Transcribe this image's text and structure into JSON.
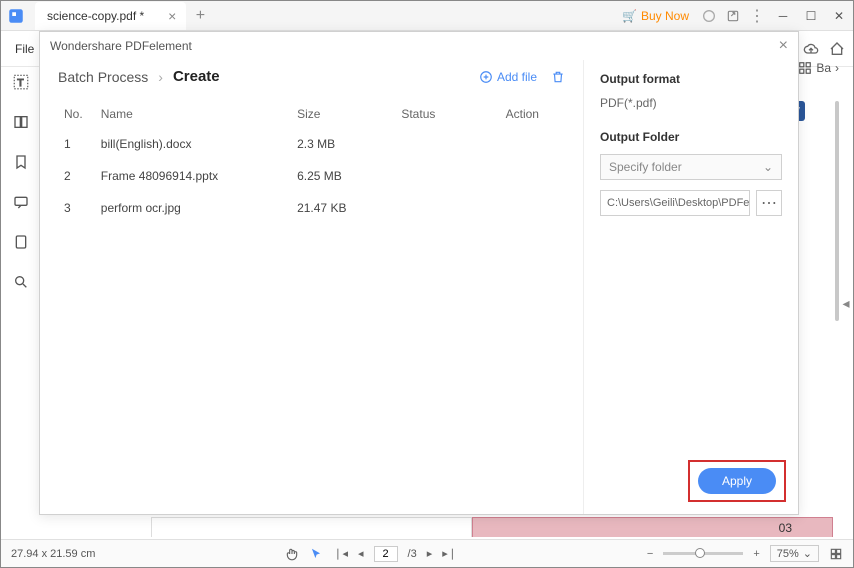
{
  "titleBar": {
    "tabTitle": "science-copy.pdf *",
    "buyNow": "Buy Now"
  },
  "topMenu": {
    "file": "File",
    "batchShort": "Ba"
  },
  "modal": {
    "title": "Wondershare PDFelement",
    "breadcrumb1": "Batch Process",
    "breadcrumb2": "Create",
    "addFile": "Add file",
    "columns": {
      "no": "No.",
      "name": "Name",
      "size": "Size",
      "status": "Status",
      "action": "Action"
    },
    "files": [
      {
        "no": "1",
        "name": "bill(English).docx",
        "size": "2.3 MB"
      },
      {
        "no": "2",
        "name": "Frame 48096914.pptx",
        "size": "6.25 MB"
      },
      {
        "no": "3",
        "name": "perform ocr.jpg",
        "size": "21.47 KB"
      }
    ],
    "outputFormatLabel": "Output format",
    "outputFormatValue": "PDF(*.pdf)",
    "outputFolderLabel": "Output Folder",
    "specifyFolder": "Specify folder",
    "folderPath": "C:\\Users\\Geili\\Desktop\\PDFelement\\Cr",
    "apply": "Apply"
  },
  "docPeek": {
    "rightNum": "03"
  },
  "statusBar": {
    "dims": "27.94 x 21.59 cm",
    "page": "2",
    "pageTotal": "/3",
    "zoom": "75%"
  }
}
